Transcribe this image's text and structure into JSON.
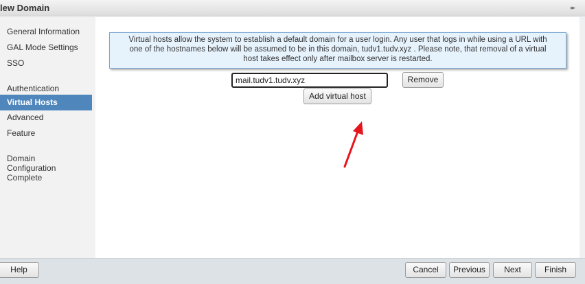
{
  "window": {
    "title": "lew Domain",
    "expand_glyph": "▸▸"
  },
  "sidebar": {
    "items": [
      {
        "label": "General Information",
        "active": false
      },
      {
        "label": "GAL Mode Settings",
        "active": false
      },
      {
        "label": "SSO",
        "active": false
      },
      {
        "label": "Authentication\nMode",
        "active": false
      },
      {
        "label": "Virtual Hosts",
        "active": true
      },
      {
        "label": "Advanced",
        "active": false
      },
      {
        "label": "Feature",
        "active": false
      },
      {
        "label": "Domain\nConfiguration\nComplete",
        "active": false
      }
    ]
  },
  "main": {
    "info_line1": "Virtual hosts allow the system to establish a default domain for a user login. Any user that logs in while using a URL with",
    "info_line2": "one of the hostnames below will be assumed to be in this domain, tudv1.tudv.xyz . Please note, that removal of a virtual",
    "info_line3": "host takes effect only after mailbox server is restarted.",
    "host_value": "mail.tudv1.tudv.xyz",
    "remove_label": "Remove",
    "add_label": "Add virtual host"
  },
  "footer": {
    "help_label": "Help",
    "cancel_label": "Cancel",
    "previous_label": "Previous",
    "next_label": "Next",
    "finish_label": "Finish"
  },
  "colors": {
    "active_nav": "#4f87bd",
    "info_bg": "#e6f2fc",
    "info_border": "#7aa7d2",
    "annotation_arrow": "#e8141c"
  },
  "icons": {
    "expand": "double-chevron-right-icon",
    "annotation": "red-arrow-icon"
  }
}
